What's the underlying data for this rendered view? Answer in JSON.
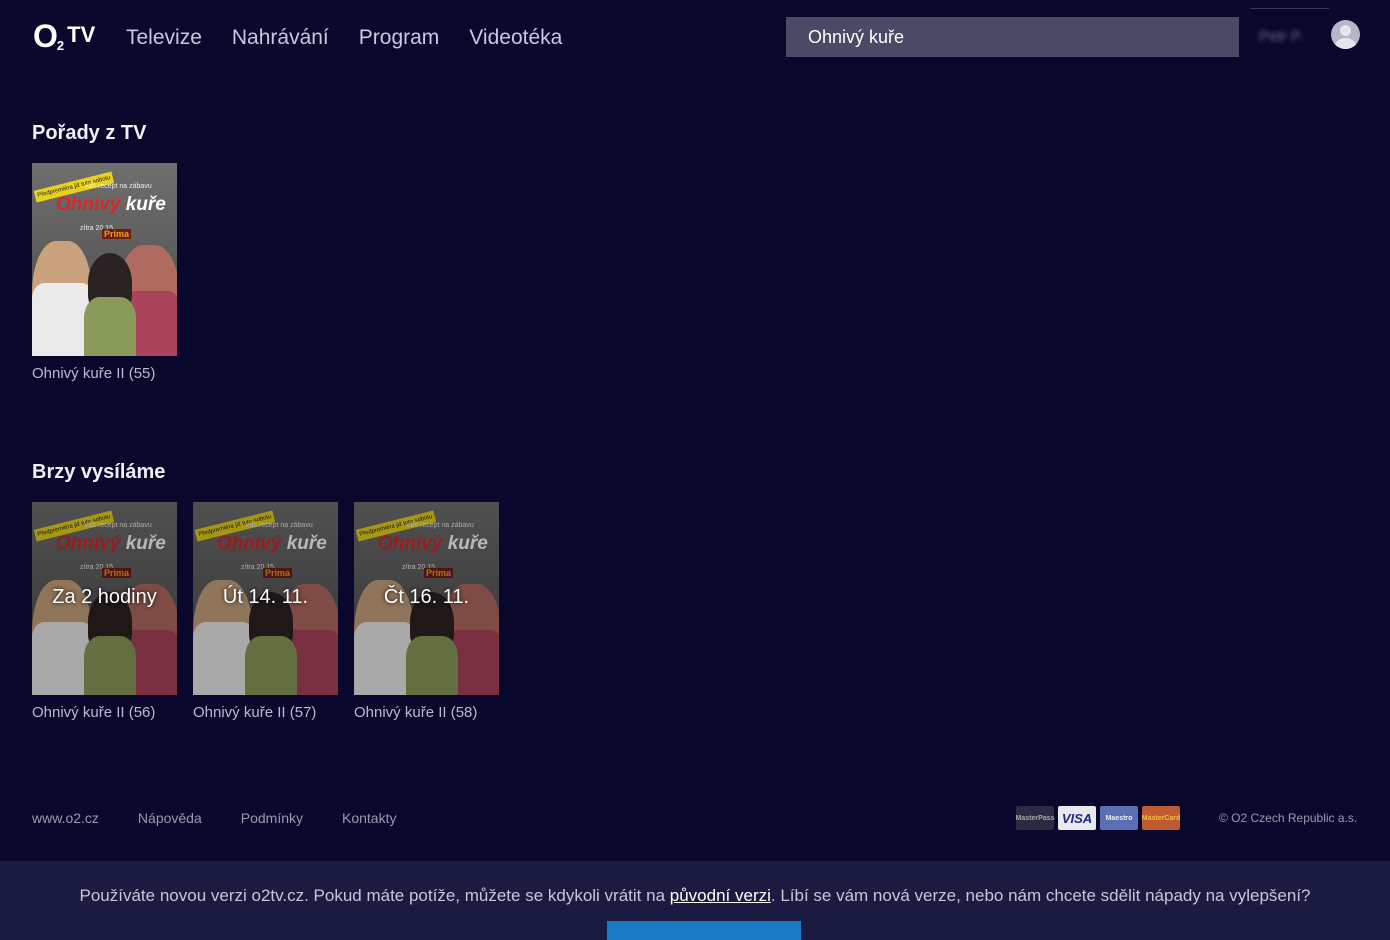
{
  "header": {
    "logo_o": "O",
    "logo_two": "2",
    "logo_tv": "TV",
    "nav": [
      "Televize",
      "Nahrávání",
      "Program",
      "Videotéka"
    ],
    "search_value": "Ohnivý kuře",
    "user_name": "Petr P."
  },
  "sections": {
    "shows_title": "Pořady z TV",
    "upcoming_title": "Brzy vysíláme"
  },
  "poster": {
    "banner": "Předpremiéra již tuto sobotu",
    "sub": "Váš recept na zábavu",
    "brand_a": "Ohnivý",
    "brand_b": "kuře",
    "time": "zítra 20.15",
    "channel": "Prima"
  },
  "shows": [
    {
      "label": "Ohnivý kuře II (55)"
    }
  ],
  "upcoming": [
    {
      "overlay": "Za 2 hodiny",
      "label": "Ohnivý kuře II (56)"
    },
    {
      "overlay": "Út 14. 11.",
      "label": "Ohnivý kuře II (57)"
    },
    {
      "overlay": "Čt 16. 11.",
      "label": "Ohnivý kuře II (58)"
    }
  ],
  "footer": {
    "links": [
      "www.o2.cz",
      "Nápověda",
      "Podmínky",
      "Kontakty"
    ],
    "payments": [
      "MasterPass",
      "VISA",
      "Maestro",
      "MasterCard"
    ],
    "copyright": "© O2 Czech Republic a.s."
  },
  "notice": {
    "text_before": "Používáte novou verzi o2tv.cz. Pokud máte potíže, můžete se kdykoli vrátit na ",
    "link": "původní verzi",
    "text_after": ". Líbí se vám nová verze, nebo nám chcete sdělit nápady na vylepšení?"
  }
}
